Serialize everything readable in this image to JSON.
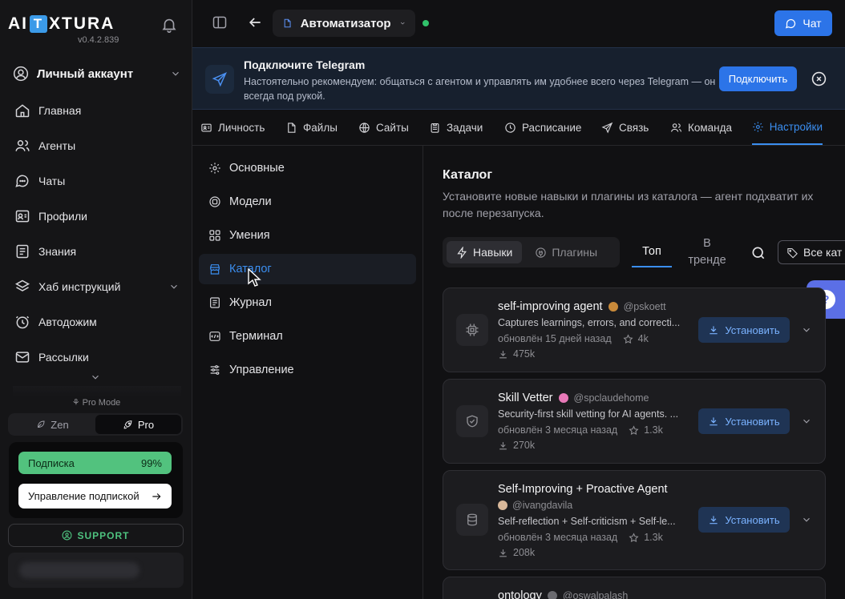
{
  "app": {
    "logo_left": "AI",
    "logo_box": "T",
    "logo_right": "XTURA",
    "version": "v0.4.2.839"
  },
  "sidebar": {
    "account": "Личный аккаунт",
    "items": [
      {
        "label": "Главная",
        "icon": "home-icon"
      },
      {
        "label": "Агенты",
        "icon": "users-icon"
      },
      {
        "label": "Чаты",
        "icon": "chat-icon"
      },
      {
        "label": "Профили",
        "icon": "profile-card-icon"
      },
      {
        "label": "Знания",
        "icon": "book-icon"
      },
      {
        "label": "Хаб инструкций",
        "icon": "layers-icon"
      },
      {
        "label": "Автодожим",
        "icon": "clock-icon"
      },
      {
        "label": "Рассылки",
        "icon": "mail-icon"
      }
    ],
    "pro_mode": "Pro Mode",
    "modes": {
      "zen": "Zen",
      "pro": "Pro"
    },
    "subscription": {
      "label": "Подписка",
      "percent": "99%",
      "manage": "Управление подпиской"
    },
    "support": "SUPPORT"
  },
  "topbar": {
    "agent_name": "Автоматизатор",
    "chat_label": "Чат"
  },
  "banner": {
    "title": "Подключите Telegram",
    "text": "Настоятельно рекомендуем: общаться с агентом и управлять им удобнее всего через Telegram — он всегда под рукой.",
    "connect": "Подключить"
  },
  "tabs": [
    "Личность",
    "Файлы",
    "Сайты",
    "Задачи",
    "Расписание",
    "Связь",
    "Команда",
    "Настройки"
  ],
  "settings_menu": [
    "Основные",
    "Модели",
    "Умения",
    "Каталог",
    "Журнал",
    "Терминал",
    "Управление"
  ],
  "catalog": {
    "title": "Каталог",
    "description": "Установите новые навыки и плагины из каталога — агент подхватит их после перезапуска.",
    "seg_skills": "Навыки",
    "seg_plugins": "Плагины",
    "sort_top": "Топ",
    "sort_trend": "В тренде",
    "all_categories": "Все кат",
    "install_label": "Установить",
    "cards": [
      {
        "name": "self-improving agent",
        "author": "@pskoett",
        "desc": "Captures learnings, errors, and correcti...",
        "updated": "обновлён 15 дней назад",
        "stars": "4k",
        "downloads": "475k",
        "icon": "chip-icon",
        "avatar_color": "#c98a3a"
      },
      {
        "name": "Skill Vetter",
        "author": "@spclaudehome",
        "desc": "Security-first skill vetting for AI agents. ...",
        "updated": "обновлён 3 месяца назад",
        "stars": "1.3k",
        "downloads": "270k",
        "icon": "shield-check-icon",
        "avatar_color": "#e879b8"
      },
      {
        "name": "Self-Improving + Proactive Agent",
        "author": "@ivangdavila",
        "desc": "Self-reflection + Self-criticism + Self-le...",
        "updated": "обновлён 3 месяца назад",
        "stars": "1.3k",
        "downloads": "208k",
        "icon": "database-icon",
        "avatar_color": "#d9b89a"
      },
      {
        "name": "ontology",
        "author": "@oswalpalash",
        "icon": "chip-icon",
        "avatar_color": "#6b6b70"
      }
    ]
  }
}
